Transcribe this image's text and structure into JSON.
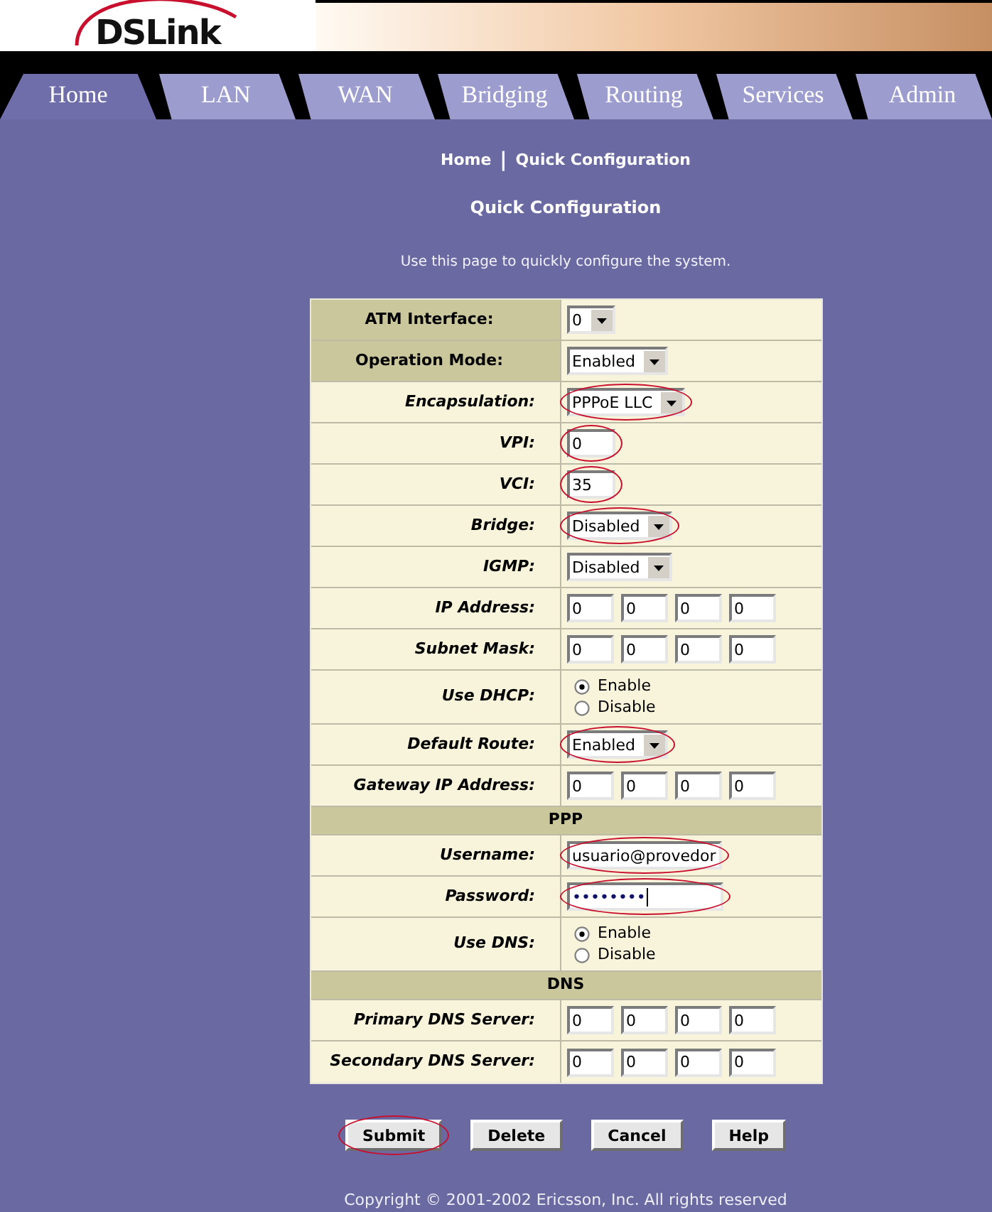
{
  "header": {
    "logo": "DSLink"
  },
  "tabs": [
    {
      "label": "Home",
      "selected": true
    },
    {
      "label": "LAN",
      "selected": false
    },
    {
      "label": "WAN",
      "selected": false
    },
    {
      "label": "Bridging",
      "selected": false
    },
    {
      "label": "Routing",
      "selected": false
    },
    {
      "label": "Services",
      "selected": false
    },
    {
      "label": "Admin",
      "selected": false
    }
  ],
  "breadcrumb": {
    "home": "Home",
    "separator": "|",
    "current": "Quick Configuration"
  },
  "title": "Quick Configuration",
  "description": "Use this page to quickly configure the system.",
  "form": {
    "rows": [
      {
        "kind": "select",
        "label": "ATM Interface:",
        "label_highlighted": true,
        "value": "0",
        "circled": false
      },
      {
        "kind": "select",
        "label": "Operation Mode:",
        "label_highlighted": true,
        "value": "Enabled",
        "circled": false
      },
      {
        "kind": "select",
        "label": "Encapsulation:",
        "label_highlighted": false,
        "value": "PPPoE LLC",
        "circled": true
      },
      {
        "kind": "text",
        "label": "VPI:",
        "label_highlighted": false,
        "value": "0",
        "circled": true
      },
      {
        "kind": "text",
        "label": "VCI:",
        "label_highlighted": false,
        "value": "35",
        "circled": true
      },
      {
        "kind": "select",
        "label": "Bridge:",
        "label_highlighted": false,
        "value": "Disabled",
        "circled": true
      },
      {
        "kind": "select",
        "label": "IGMP:",
        "label_highlighted": false,
        "value": "Disabled",
        "circled": false
      },
      {
        "kind": "ip",
        "label": "IP Address:",
        "label_highlighted": false,
        "octets": [
          "0",
          "0",
          "0",
          "0"
        ]
      },
      {
        "kind": "ip",
        "label": "Subnet Mask:",
        "label_highlighted": false,
        "octets": [
          "0",
          "0",
          "0",
          "0"
        ]
      },
      {
        "kind": "radio",
        "label": "Use DHCP:",
        "label_highlighted": false,
        "options": [
          {
            "label": "Enable",
            "selected": true
          },
          {
            "label": "Disable",
            "selected": false
          }
        ]
      },
      {
        "kind": "select",
        "label": "Default Route:",
        "label_highlighted": false,
        "value": "Enabled",
        "circled": true
      },
      {
        "kind": "ip",
        "label": "Gateway IP Address:",
        "label_highlighted": false,
        "octets": [
          "0",
          "0",
          "0",
          "0"
        ]
      },
      {
        "kind": "section",
        "title": "PPP"
      },
      {
        "kind": "text",
        "label": "Username:",
        "label_highlighted": false,
        "value": "usuario@provedor",
        "circled": true
      },
      {
        "kind": "password",
        "label": "Password:",
        "label_highlighted": false,
        "value": "••••••••",
        "focused": true,
        "circled": true
      },
      {
        "kind": "radio",
        "label": "Use DNS:",
        "label_highlighted": false,
        "options": [
          {
            "label": "Enable",
            "selected": true
          },
          {
            "label": "Disable",
            "selected": false
          }
        ]
      },
      {
        "kind": "section",
        "title": "DNS"
      },
      {
        "kind": "ip",
        "label": "Primary DNS Server:",
        "label_highlighted": false,
        "octets": [
          "0",
          "0",
          "0",
          "0"
        ]
      },
      {
        "kind": "ip",
        "label": "Secondary DNS Server:",
        "label_highlighted": false,
        "octets": [
          "0",
          "0",
          "0",
          "0"
        ]
      }
    ]
  },
  "buttons": [
    {
      "label": "Submit",
      "circled": true
    },
    {
      "label": "Delete",
      "circled": false
    },
    {
      "label": "Cancel",
      "circled": false
    },
    {
      "label": "Help",
      "circled": false
    }
  ],
  "footer": {
    "copyright": "Copyright © 2001-2002 Ericsson, Inc. All rights reserved"
  }
}
